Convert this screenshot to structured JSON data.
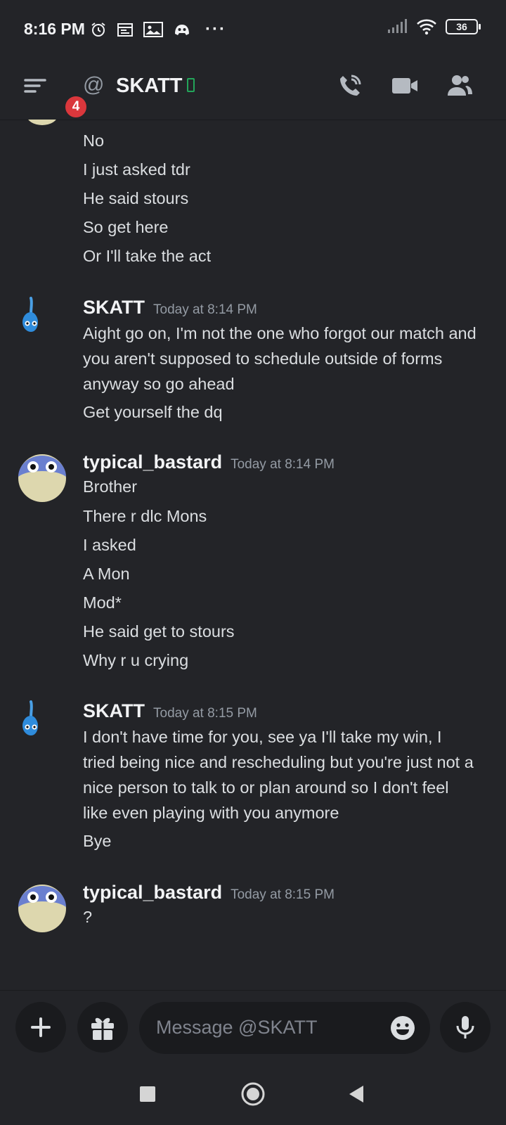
{
  "status_bar": {
    "time": "8:16 PM",
    "battery": "36"
  },
  "header": {
    "badge": "4",
    "channel_name": "SKATT"
  },
  "messages": {
    "m0": {
      "lines": [
        "No",
        "I just asked tdr",
        "He said stours",
        "So get here",
        "Or I'll take the act"
      ]
    },
    "m1": {
      "author": "SKATT",
      "timestamp": "Today at 8:14 PM",
      "lines": [
        "Aight go on, I'm not the one who forgot our match and",
        "you aren't supposed to schedule outside of forms",
        "anyway so go ahead",
        "Get yourself the dq"
      ]
    },
    "m2": {
      "author": "typical_bastard",
      "timestamp": "Today at 8:14 PM",
      "lines": [
        "Brother",
        "There r dlc Mons",
        "I asked",
        "A Mon",
        "Mod*",
        "He said get to stours",
        "Why r u crying"
      ]
    },
    "m3": {
      "author": "SKATT",
      "timestamp": "Today at 8:15 PM",
      "lines": [
        "I don't have time for you, see ya I'll take my win, I",
        "tried being nice and rescheduling but you're just not a",
        "nice person to talk to or plan around so I don't feel",
        "like even playing with you anymore",
        "Bye"
      ]
    },
    "m4": {
      "author": "typical_bastard",
      "timestamp": "Today at 8:15 PM",
      "lines": [
        "?"
      ]
    }
  },
  "composer": {
    "placeholder": "Message @SKATT"
  },
  "icons": {
    "alarm": "alarm-icon",
    "calendar": "calendar-icon",
    "gallery": "gallery-icon",
    "discord": "discord-icon",
    "more": "more-dots-icon",
    "signal": "signal-icon",
    "wifi": "wifi-icon",
    "menu": "hamburger-menu-icon",
    "at": "at-icon",
    "mobile": "mobile-status-icon",
    "call": "phone-call-icon",
    "video": "video-camera-icon",
    "members": "members-icon",
    "add": "plus-icon",
    "gift": "gift-icon",
    "emoji": "emoji-icon",
    "mic": "microphone-icon",
    "nav_recent": "recents-square-icon",
    "nav_home": "home-circle-icon",
    "nav_back": "back-triangle-icon"
  },
  "colors": {
    "background": "#313338",
    "text": "#dbdee1",
    "muted": "#949ba4",
    "badge": "#da373c",
    "online_mobile": "#23a55a"
  }
}
